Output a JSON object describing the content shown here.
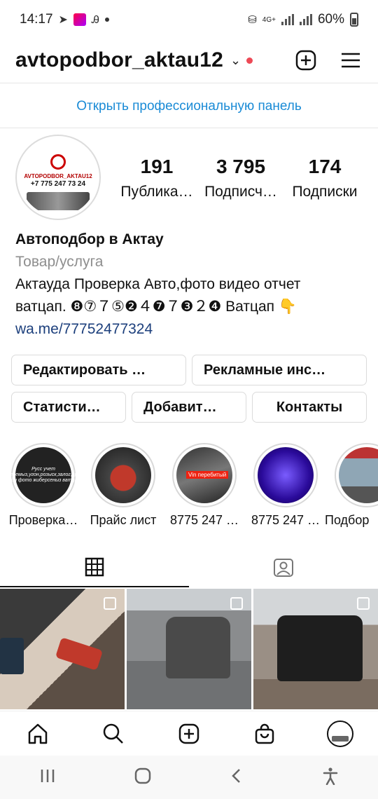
{
  "status_bar": {
    "time": "14:17",
    "network": "4G+",
    "battery": "60%"
  },
  "header": {
    "username": "avtopodbor_aktau12",
    "caret": "⌄",
    "new_post_icon": "plus-square-icon",
    "menu_icon": "hamburger-menu-icon"
  },
  "pro_panel": {
    "label": "Открыть профессиональную панель"
  },
  "avatar": {
    "line1": "AVTOPODBOR_AKTAU12",
    "line2": "+7 775 247 73 24"
  },
  "stats": [
    {
      "count": "191",
      "label": "Публика…"
    },
    {
      "count": "3 795",
      "label": "Подписч…"
    },
    {
      "count": "174",
      "label": "Подписки"
    }
  ],
  "bio": {
    "name": "Автоподбор в Актау",
    "category": "Товар/услуга",
    "line1": "Актауда Проверка Авто,фото видео отчет",
    "line2": "ватцап. ❽⑦７⑤❷４❼７❸２❹ Ватцап 👇",
    "link": "wa.me/77752477324"
  },
  "buttons": {
    "edit": "Редактировать …",
    "ads": "Рекламные инс…",
    "stats": "Статисти…",
    "add": "Добавит…",
    "contacts": "Контакты"
  },
  "highlights": [
    {
      "label": "Проверка…",
      "cover_text": "Русс учет гексеремыз,угон,розыск,залог,арест онлайн фото жиберсеныз ватцапка."
    },
    {
      "label": "Прайс лист"
    },
    {
      "label": "8775 247 …",
      "cover_text": "Vin перебитый"
    },
    {
      "label": "8775 247 …"
    },
    {
      "label": "Подбор"
    }
  ],
  "tabs": [
    {
      "icon": "grid-icon"
    },
    {
      "icon": "tagged-person-icon"
    }
  ],
  "bottom_nav": [
    {
      "icon": "home-icon"
    },
    {
      "icon": "search-icon"
    },
    {
      "icon": "create-icon"
    },
    {
      "icon": "shop-icon"
    },
    {
      "icon": "profile-avatar-icon"
    }
  ],
  "colors": {
    "link_blue": "#1a8bd6",
    "notification_red": "#ed4956"
  }
}
